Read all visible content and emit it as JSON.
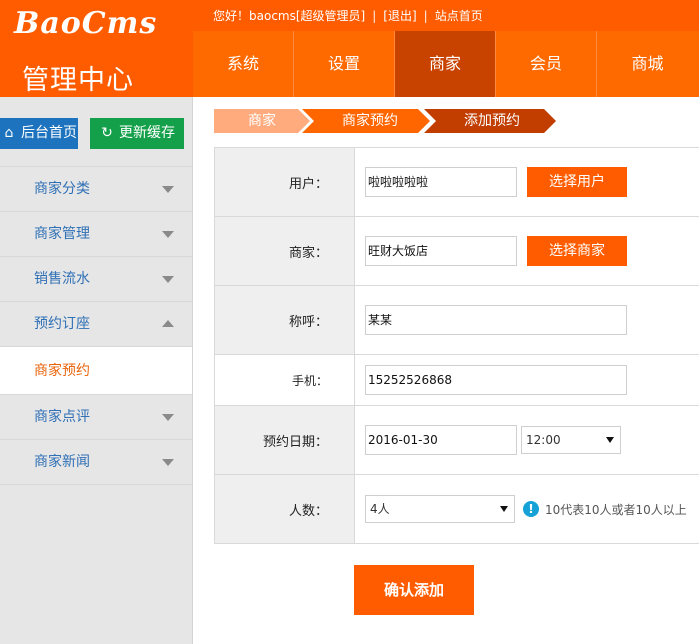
{
  "header": {
    "logo": "BaoCms",
    "logo_sub": "管理中心",
    "topbar": {
      "greeting": "您好！baocms[超级管理员]",
      "logout": "[退出]",
      "site_home": "站点首页"
    },
    "nav": [
      "系统",
      "设置",
      "商家",
      "会员",
      "商城"
    ],
    "active_nav": "商家"
  },
  "sidebar": {
    "home_button": "后台首页",
    "refresh_button": "更新缓存",
    "items": [
      {
        "label": "商家分类",
        "expanded": false
      },
      {
        "label": "商家管理",
        "expanded": false
      },
      {
        "label": "销售流水",
        "expanded": false
      },
      {
        "label": "预约订座",
        "expanded": true,
        "sub": "商家预约"
      },
      {
        "label": "商家点评",
        "expanded": false
      },
      {
        "label": "商家新闻",
        "expanded": false
      }
    ]
  },
  "breadcrumb": [
    "商家",
    "商家预约",
    "添加预约"
  ],
  "form": {
    "user_label": "用户：",
    "user_value": "啦啦啦啦啦",
    "user_button": "选择用户",
    "shop_label": "商家：",
    "shop_value": "旺财大饭店",
    "shop_button": "选择商家",
    "name_label": "称呼：",
    "name_value": "某某",
    "mobile_label": "手机：",
    "mobile_value": "15252526868",
    "date_label": "预约日期：",
    "date_value": "2016-01-30",
    "time_value": "12:00",
    "people_label": "人数：",
    "people_value": "4人",
    "people_hint": "10代表10人或者10人以上",
    "submit": "确认添加"
  },
  "colors": {
    "brand": "#ff5c00",
    "nav_active": "#c94300",
    "home_btn": "#1e73be",
    "refresh_btn": "#14a04a",
    "link": "#2f70b6"
  }
}
